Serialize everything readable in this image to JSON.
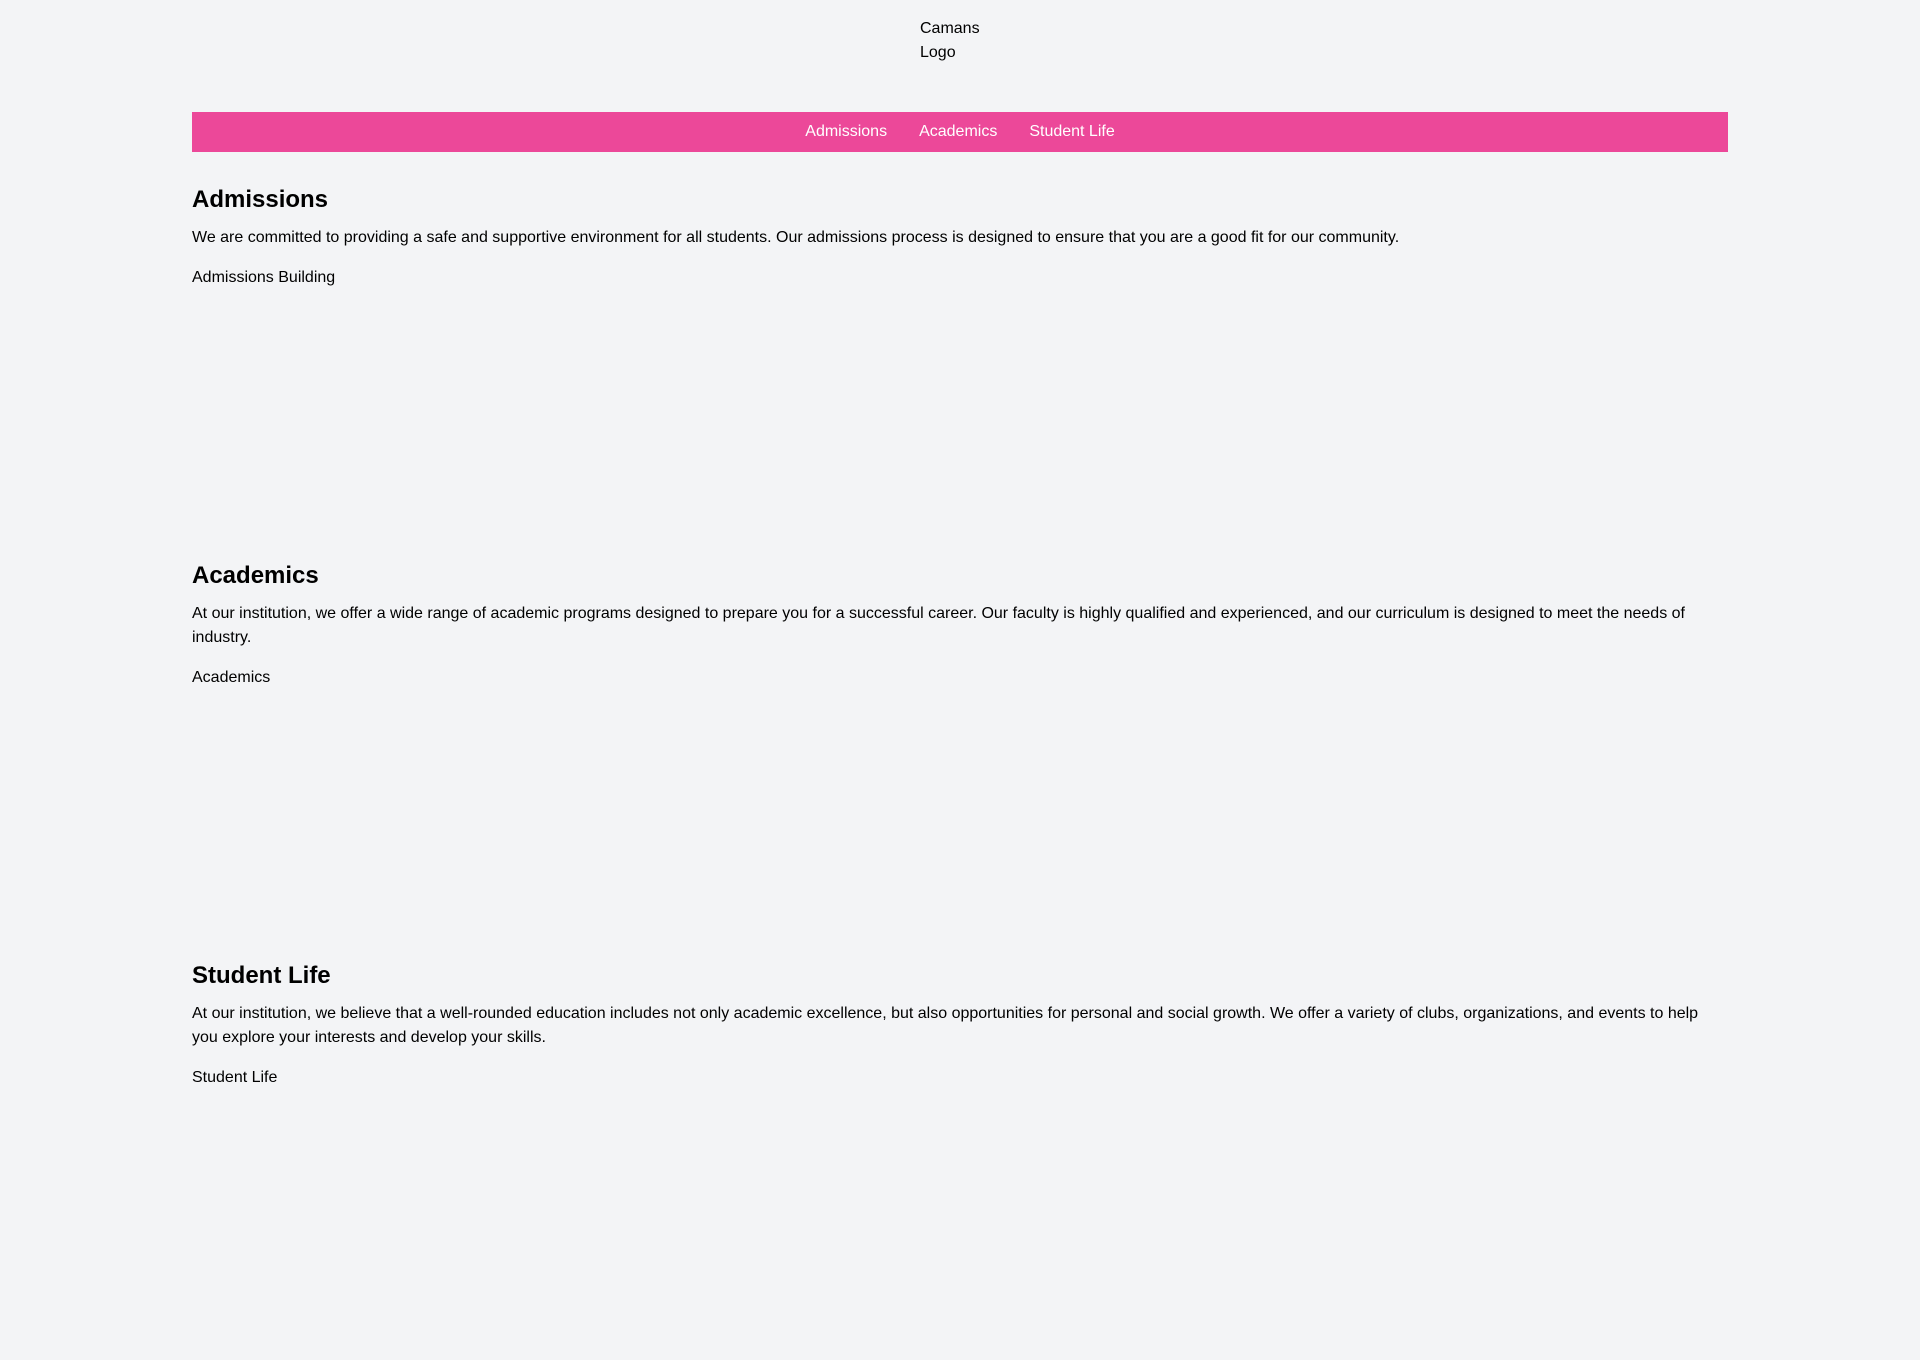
{
  "header": {
    "logo_alt": "Camans Logo"
  },
  "nav": {
    "items": [
      {
        "label": "Admissions"
      },
      {
        "label": "Academics"
      },
      {
        "label": "Student Life"
      }
    ],
    "background_color": "#ec4899"
  },
  "sections": [
    {
      "title": "Admissions",
      "text": "We are committed to providing a safe and supportive environment for all students. Our admissions process is designed to ensure that you are a good fit for our community.",
      "image_alt": "Admissions Building"
    },
    {
      "title": "Academics",
      "text": "At our institution, we offer a wide range of academic programs designed to prepare you for a successful career. Our faculty is highly qualified and experienced, and our curriculum is designed to meet the needs of industry.",
      "image_alt": "Academics"
    },
    {
      "title": "Student Life",
      "text": "At our institution, we believe that a well-rounded education includes not only academic excellence, but also opportunities for personal and social growth. We offer a variety of clubs, organizations, and events to help you explore your interests and develop your skills.",
      "image_alt": "Student Life"
    }
  ]
}
